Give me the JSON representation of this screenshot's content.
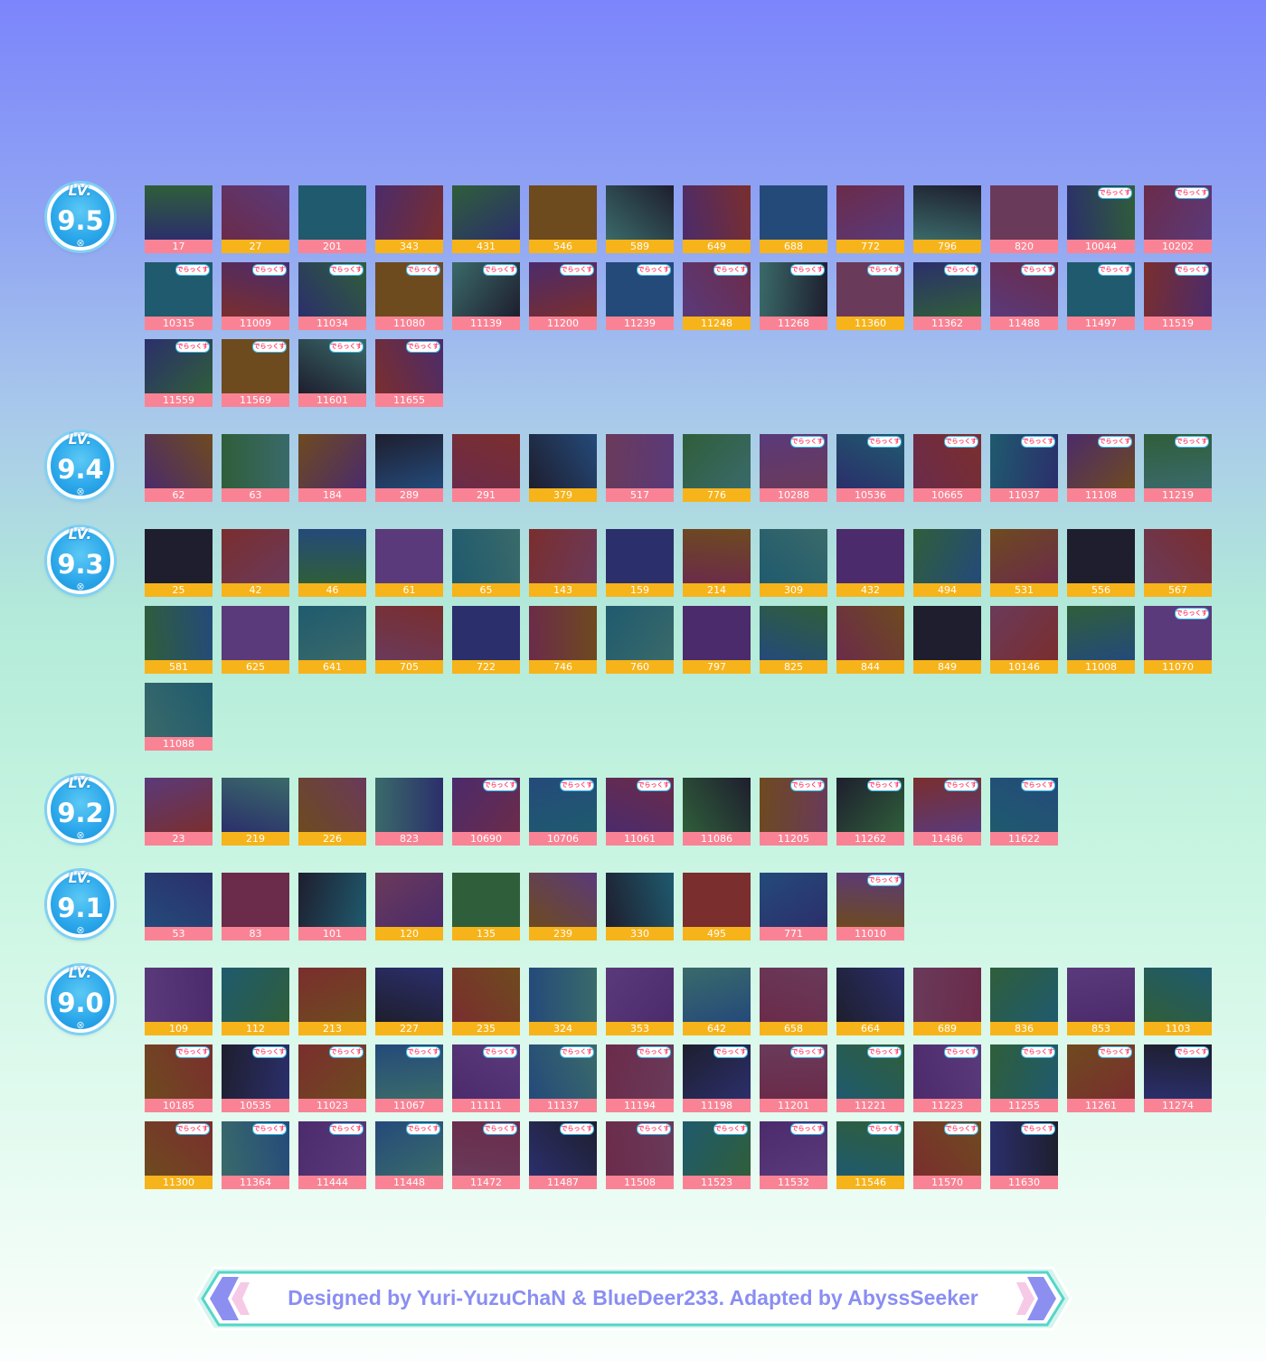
{
  "colors": {
    "id_bar_standard": "#f7b31a",
    "id_bar_dx": "#f98395",
    "badge_blue": "#2aa6ea",
    "footer_text": "#8a8ef2"
  },
  "levels": [
    {
      "label": "LV.",
      "value": "9.5",
      "songs": [
        {
          "id": "17",
          "type": "dx"
        },
        {
          "id": "27",
          "type": "standard"
        },
        {
          "id": "201",
          "type": "dx"
        },
        {
          "id": "343",
          "type": "standard"
        },
        {
          "id": "431",
          "type": "standard"
        },
        {
          "id": "546",
          "type": "standard"
        },
        {
          "id": "589",
          "type": "standard"
        },
        {
          "id": "649",
          "type": "standard"
        },
        {
          "id": "688",
          "type": "standard"
        },
        {
          "id": "772",
          "type": "standard"
        },
        {
          "id": "796",
          "type": "standard"
        },
        {
          "id": "820",
          "type": "dx"
        },
        {
          "id": "10044",
          "type": "dx",
          "tag": "でらっくす"
        },
        {
          "id": "10202",
          "type": "dx",
          "tag": "でらっくす"
        },
        {
          "id": "10315",
          "type": "dx",
          "tag": "でらっくす"
        },
        {
          "id": "11009",
          "type": "dx",
          "tag": "でらっくす"
        },
        {
          "id": "11034",
          "type": "dx",
          "tag": "でらっくす"
        },
        {
          "id": "11080",
          "type": "dx",
          "tag": "でらっくす"
        },
        {
          "id": "11139",
          "type": "dx",
          "tag": "でらっくす"
        },
        {
          "id": "11200",
          "type": "dx",
          "tag": "でらっくす"
        },
        {
          "id": "11239",
          "type": "dx",
          "tag": "でらっくす"
        },
        {
          "id": "11248",
          "type": "standard",
          "tag": "でらっくす"
        },
        {
          "id": "11268",
          "type": "dx",
          "tag": "でらっくす"
        },
        {
          "id": "11360",
          "type": "standard",
          "tag": "でらっくす"
        },
        {
          "id": "11362",
          "type": "dx",
          "tag": "でらっくす"
        },
        {
          "id": "11488",
          "type": "dx",
          "tag": "でらっくす"
        },
        {
          "id": "11497",
          "type": "dx",
          "tag": "でらっくす"
        },
        {
          "id": "11519",
          "type": "dx",
          "tag": "でらっくす"
        },
        {
          "id": "11559",
          "type": "dx",
          "tag": "でらっくす"
        },
        {
          "id": "11569",
          "type": "dx",
          "tag": "でらっくす"
        },
        {
          "id": "11601",
          "type": "dx",
          "tag": "でらっくす"
        },
        {
          "id": "11655",
          "type": "dx",
          "tag": "でらっくす"
        }
      ]
    },
    {
      "label": "LV.",
      "value": "9.4",
      "songs": [
        {
          "id": "62",
          "type": "dx"
        },
        {
          "id": "63",
          "type": "dx"
        },
        {
          "id": "184",
          "type": "dx"
        },
        {
          "id": "289",
          "type": "dx"
        },
        {
          "id": "291",
          "type": "dx"
        },
        {
          "id": "379",
          "type": "standard"
        },
        {
          "id": "517",
          "type": "dx"
        },
        {
          "id": "776",
          "type": "standard"
        },
        {
          "id": "10288",
          "type": "dx",
          "tag": "でらっくす"
        },
        {
          "id": "10536",
          "type": "dx",
          "tag": "でらっくす"
        },
        {
          "id": "10665",
          "type": "dx",
          "tag": "でらっくす"
        },
        {
          "id": "11037",
          "type": "dx",
          "tag": "でらっくす"
        },
        {
          "id": "11108",
          "type": "dx",
          "tag": "でらっくす"
        },
        {
          "id": "11219",
          "type": "dx",
          "tag": "でらっくす"
        }
      ]
    },
    {
      "label": "LV.",
      "value": "9.3",
      "songs": [
        {
          "id": "25",
          "type": "standard"
        },
        {
          "id": "42",
          "type": "standard"
        },
        {
          "id": "46",
          "type": "standard"
        },
        {
          "id": "61",
          "type": "standard"
        },
        {
          "id": "65",
          "type": "standard"
        },
        {
          "id": "143",
          "type": "standard"
        },
        {
          "id": "159",
          "type": "standard"
        },
        {
          "id": "214",
          "type": "standard"
        },
        {
          "id": "309",
          "type": "standard"
        },
        {
          "id": "432",
          "type": "standard"
        },
        {
          "id": "494",
          "type": "standard"
        },
        {
          "id": "531",
          "type": "standard"
        },
        {
          "id": "556",
          "type": "standard"
        },
        {
          "id": "567",
          "type": "standard"
        },
        {
          "id": "581",
          "type": "standard"
        },
        {
          "id": "625",
          "type": "standard"
        },
        {
          "id": "641",
          "type": "standard"
        },
        {
          "id": "705",
          "type": "standard"
        },
        {
          "id": "722",
          "type": "standard"
        },
        {
          "id": "746",
          "type": "standard"
        },
        {
          "id": "760",
          "type": "standard"
        },
        {
          "id": "797",
          "type": "standard"
        },
        {
          "id": "825",
          "type": "standard"
        },
        {
          "id": "844",
          "type": "standard"
        },
        {
          "id": "849",
          "type": "standard"
        },
        {
          "id": "10146",
          "type": "standard"
        },
        {
          "id": "11008",
          "type": "standard"
        },
        {
          "id": "11070",
          "type": "standard",
          "tag": "でらっくす"
        },
        {
          "id": "11088",
          "type": "dx"
        }
      ]
    },
    {
      "label": "LV.",
      "value": "9.2",
      "songs": [
        {
          "id": "23",
          "type": "dx"
        },
        {
          "id": "219",
          "type": "standard"
        },
        {
          "id": "226",
          "type": "standard"
        },
        {
          "id": "823",
          "type": "dx"
        },
        {
          "id": "10690",
          "type": "dx",
          "tag": "でらっくす"
        },
        {
          "id": "10706",
          "type": "dx",
          "tag": "でらっくす"
        },
        {
          "id": "11061",
          "type": "dx",
          "tag": "でらっくす"
        },
        {
          "id": "11086",
          "type": "dx"
        },
        {
          "id": "11205",
          "type": "dx",
          "tag": "でらっくす"
        },
        {
          "id": "11262",
          "type": "dx",
          "tag": "でらっくす"
        },
        {
          "id": "11486",
          "type": "dx",
          "tag": "でらっくす"
        },
        {
          "id": "11622",
          "type": "dx",
          "tag": "でらっくす"
        }
      ]
    },
    {
      "label": "LV.",
      "value": "9.1",
      "songs": [
        {
          "id": "53",
          "type": "dx"
        },
        {
          "id": "83",
          "type": "dx"
        },
        {
          "id": "101",
          "type": "dx"
        },
        {
          "id": "120",
          "type": "standard"
        },
        {
          "id": "135",
          "type": "standard"
        },
        {
          "id": "239",
          "type": "standard"
        },
        {
          "id": "330",
          "type": "standard"
        },
        {
          "id": "495",
          "type": "standard"
        },
        {
          "id": "771",
          "type": "dx"
        },
        {
          "id": "11010",
          "type": "dx",
          "tag": "でらっくす"
        }
      ]
    },
    {
      "label": "LV.",
      "value": "9.0",
      "songs": [
        {
          "id": "109",
          "type": "standard"
        },
        {
          "id": "112",
          "type": "standard"
        },
        {
          "id": "213",
          "type": "standard"
        },
        {
          "id": "227",
          "type": "standard"
        },
        {
          "id": "235",
          "type": "standard"
        },
        {
          "id": "324",
          "type": "standard"
        },
        {
          "id": "353",
          "type": "standard"
        },
        {
          "id": "642",
          "type": "standard"
        },
        {
          "id": "658",
          "type": "standard"
        },
        {
          "id": "664",
          "type": "standard"
        },
        {
          "id": "689",
          "type": "standard"
        },
        {
          "id": "836",
          "type": "standard"
        },
        {
          "id": "853",
          "type": "standard"
        },
        {
          "id": "1103",
          "type": "standard"
        },
        {
          "id": "10185",
          "type": "dx",
          "tag": "でらっくす"
        },
        {
          "id": "10535",
          "type": "dx",
          "tag": "でらっくす"
        },
        {
          "id": "11023",
          "type": "dx",
          "tag": "でらっくす"
        },
        {
          "id": "11067",
          "type": "dx",
          "tag": "でらっくす"
        },
        {
          "id": "11111",
          "type": "dx",
          "tag": "でらっくす"
        },
        {
          "id": "11137",
          "type": "dx",
          "tag": "でらっくす"
        },
        {
          "id": "11194",
          "type": "dx",
          "tag": "でらっくす"
        },
        {
          "id": "11198",
          "type": "dx",
          "tag": "でらっくす"
        },
        {
          "id": "11201",
          "type": "dx",
          "tag": "でらっくす"
        },
        {
          "id": "11221",
          "type": "dx",
          "tag": "でらっくす"
        },
        {
          "id": "11223",
          "type": "dx",
          "tag": "でらっくす"
        },
        {
          "id": "11255",
          "type": "dx",
          "tag": "でらっくす"
        },
        {
          "id": "11261",
          "type": "dx",
          "tag": "でらっくす"
        },
        {
          "id": "11274",
          "type": "dx",
          "tag": "でらっくす"
        },
        {
          "id": "11300",
          "type": "standard",
          "tag": "でらっくす"
        },
        {
          "id": "11364",
          "type": "dx",
          "tag": "でらっくす"
        },
        {
          "id": "11444",
          "type": "dx",
          "tag": "でらっくす"
        },
        {
          "id": "11448",
          "type": "dx",
          "tag": "でらっくす"
        },
        {
          "id": "11472",
          "type": "dx",
          "tag": "でらっくす"
        },
        {
          "id": "11487",
          "type": "dx",
          "tag": "でらっくす"
        },
        {
          "id": "11508",
          "type": "dx",
          "tag": "でらっくす"
        },
        {
          "id": "11523",
          "type": "dx",
          "tag": "でらっくす"
        },
        {
          "id": "11532",
          "type": "dx",
          "tag": "でらっくす"
        },
        {
          "id": "11546",
          "type": "standard",
          "tag": "でらっくす"
        },
        {
          "id": "11570",
          "type": "dx",
          "tag": "でらっくす"
        },
        {
          "id": "11630",
          "type": "dx",
          "tag": "でらっくす"
        }
      ]
    }
  ],
  "footer": {
    "credit": "Designed by Yuri-YuzuChaN & BlueDeer233. Adapted by AbyssSeeker"
  }
}
